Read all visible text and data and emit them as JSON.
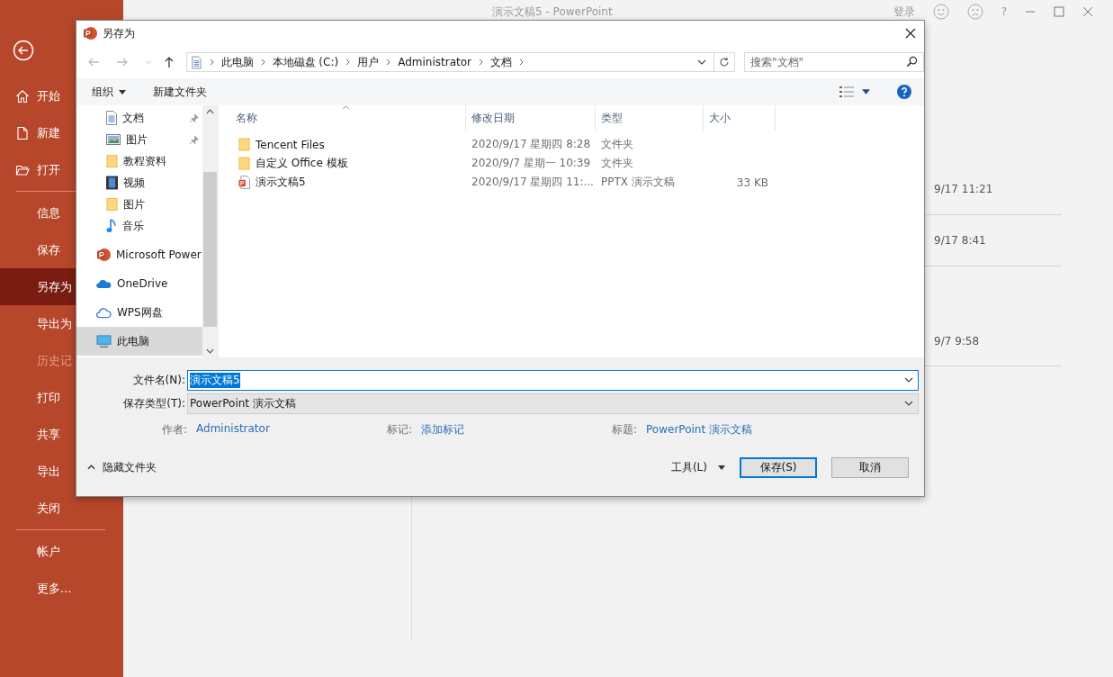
{
  "window": {
    "title": "演示文稿5  -  PowerPoint",
    "sign_in": "登录",
    "help": "?"
  },
  "backstage": {
    "groups": [
      [
        {
          "label": "开始",
          "selected": false,
          "disabled": false
        },
        {
          "label": "新建",
          "selected": false,
          "disabled": false
        },
        {
          "label": "打开",
          "selected": false,
          "disabled": false
        }
      ],
      [
        {
          "label": "信息",
          "selected": false,
          "disabled": false
        },
        {
          "label": "保存",
          "selected": false,
          "disabled": false
        },
        {
          "label": "另存为",
          "selected": true,
          "disabled": false
        },
        {
          "label": "导出为",
          "selected": false,
          "disabled": false
        },
        {
          "label": "历史记",
          "selected": false,
          "disabled": true
        },
        {
          "label": "打印",
          "selected": false,
          "disabled": false
        },
        {
          "label": "共享",
          "selected": false,
          "disabled": false
        },
        {
          "label": "导出",
          "selected": false,
          "disabled": false
        },
        {
          "label": "关闭",
          "selected": false,
          "disabled": false
        }
      ],
      [
        {
          "label": "帐户",
          "selected": false,
          "disabled": false
        },
        {
          "label": "更多...",
          "selected": false,
          "disabled": false
        }
      ]
    ]
  },
  "recent_dates": [
    "9/17 11:21",
    "9/17 8:41",
    "9/7 9:58"
  ],
  "dialog": {
    "title": "另存为",
    "breadcrumb": [
      "此电脑",
      "本地磁盘 (C:)",
      "用户",
      "Administrator",
      "文档"
    ],
    "search": {
      "placeholder": "搜索\"文档\""
    },
    "toolbar": {
      "organize": "组织",
      "new_folder": "新建文件夹"
    },
    "nav": [
      [
        {
          "label": "文档",
          "kind": "documents",
          "pinned": true,
          "selected": false
        },
        {
          "label": "图片",
          "kind": "pictures",
          "pinned": true,
          "selected": false
        },
        {
          "label": "教程资料",
          "kind": "folder",
          "pinned": false,
          "selected": false
        },
        {
          "label": "视频",
          "kind": "videos",
          "pinned": false,
          "selected": false
        },
        {
          "label": "图片",
          "kind": "folder",
          "pinned": false,
          "selected": false
        },
        {
          "label": "音乐",
          "kind": "music",
          "pinned": false,
          "selected": false
        }
      ],
      [
        {
          "label": "Microsoft Power",
          "kind": "app",
          "pinned": false,
          "selected": false
        }
      ],
      [
        {
          "label": "OneDrive",
          "kind": "onedrive",
          "pinned": false,
          "selected": false
        }
      ],
      [
        {
          "label": "WPS网盘",
          "kind": "netdisk",
          "pinned": false,
          "selected": false
        }
      ],
      [
        {
          "label": "此电脑",
          "kind": "computer",
          "pinned": false,
          "selected": true
        }
      ]
    ],
    "columns": [
      "名称",
      "修改日期",
      "类型",
      "大小"
    ],
    "files": [
      {
        "kind": "folder",
        "name": "Tencent Files",
        "modified": "2020/9/17 星期四 8:28",
        "type": "文件夹"
      },
      {
        "kind": "folder",
        "name": "自定义 Office 模板",
        "modified": "2020/9/7 星期一 10:39",
        "type": "文件夹"
      },
      {
        "kind": "presentation",
        "name": "演示文稿5",
        "modified": "2020/9/17 星期四 11:...",
        "type": "PPTX 演示文稿",
        "size": "33 KB"
      }
    ],
    "file_name": {
      "label": "文件名(N):",
      "value": "演示文稿5",
      "text_selected": true
    },
    "file_type": {
      "label": "保存类型(T):",
      "value": "PowerPoint 演示文稿"
    },
    "meta": [
      {
        "label": "作者:",
        "value": "Administrator"
      },
      {
        "label": "标记:",
        "value": "添加标记"
      },
      {
        "label": "标题:",
        "value": "PowerPoint 演示文稿"
      }
    ],
    "hide_folders": "隐藏文件夹",
    "buttons": [
      {
        "kind": "menu",
        "label": "工具(L)"
      },
      {
        "kind": "default",
        "label": "保存(S)"
      },
      {
        "kind": "plain",
        "label": "取消"
      }
    ]
  }
}
